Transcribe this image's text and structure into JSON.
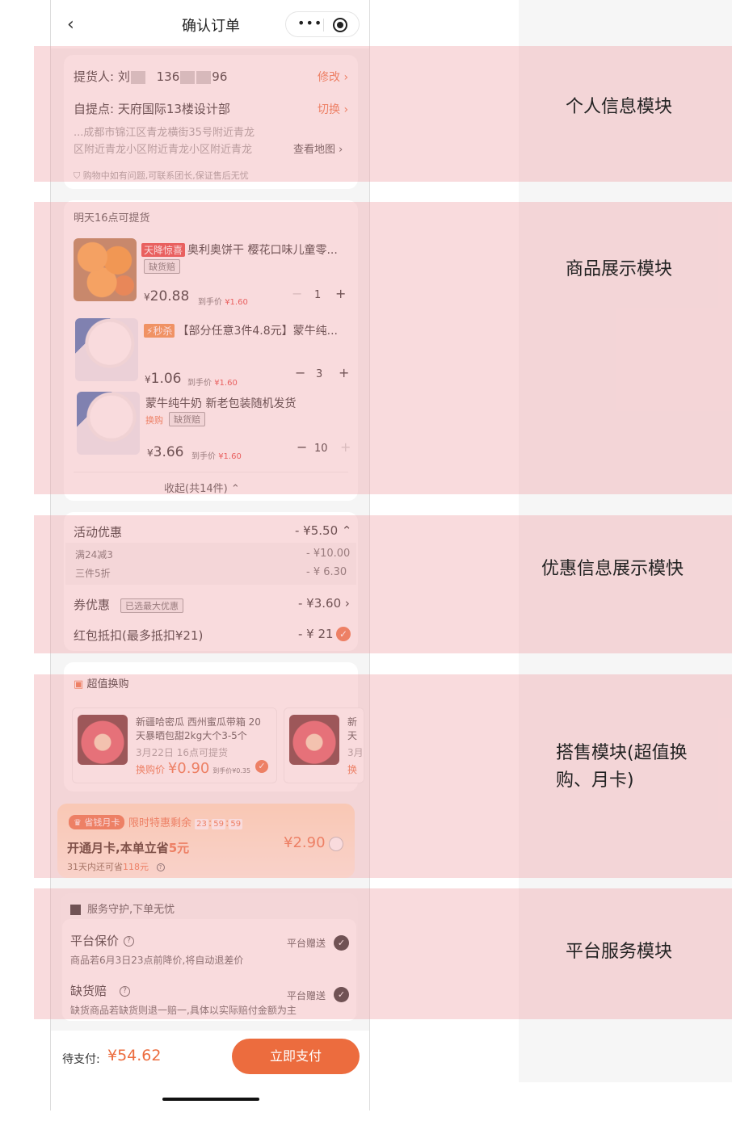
{
  "nav": {
    "back_icon": "‹",
    "title": "确认订单",
    "more_icon": "•••"
  },
  "person": {
    "picker_label": "提货人:",
    "picker_name": "刘",
    "phone_start": "136",
    "phone_end": "96",
    "edit": "修改",
    "pickup_label": "自提点:",
    "pickup_name": "天府国际13楼设计部",
    "switch": "切换",
    "addr1": "...成都市锦江区青龙横街35号附近青龙",
    "addr2": "区附近青龙小区附近青龙小区附近青龙",
    "view_map": "查看地图",
    "guarantee": "购物中如有问题,可联系团长,保证售后无忧"
  },
  "products": {
    "pickup_time": "明天16点可提货",
    "items": [
      {
        "tag": "天降惊喜",
        "name": "奥利奥饼干 樱花口味儿童零...",
        "badge": "缺货赔",
        "price": "20.88",
        "after_label": "到手价",
        "after_price": "¥1.60",
        "qty": "1"
      },
      {
        "tag": "秒杀",
        "name": "【部分任意3件4.8元】蒙牛纯...",
        "price": "1.06",
        "after_label": "到手价",
        "after_price": "¥1.60",
        "qty": "3"
      },
      {
        "name": "蒙牛纯牛奶 新老包装随机发货",
        "swap": "换购",
        "badge": "缺货赔",
        "price": "3.66",
        "after_label": "到手价",
        "after_price": "¥1.60",
        "qty": "10"
      }
    ],
    "collapse": "收起(共14件)",
    "currency": "¥"
  },
  "discount": {
    "activity_label": "活动优惠",
    "activity_amount": "- ¥5.50",
    "sub1_label": "满24减3",
    "sub1_amount": "- ¥10.00",
    "sub2_label": "三件5折",
    "sub2_amount": "- ¥ 6.30",
    "coupon_label": "券优惠",
    "coupon_badge": "已选最大优惠",
    "coupon_amount": "- ¥3.60",
    "redpack_label": "红包抵扣(最多抵扣¥21)",
    "redpack_amount": "- ¥ 21"
  },
  "swap": {
    "title": "超值换购",
    "item_title1": "新疆哈密瓜 西州蜜瓜带箱 20",
    "item_title2": "天暴晒包甜2kg大个3-5个",
    "item_time": "3月22日 16点可提货",
    "item_price_label": "换购价",
    "item_price": "¥0.90",
    "item_after": "到手价¥0.35",
    "peek_title1": "新",
    "peek_title2": "天",
    "peek_time": "3月",
    "peek_price": "换"
  },
  "month_card": {
    "badge": "省钱月卡",
    "promo": "限时特惠剩余",
    "t_h": "23",
    "t_m": "59",
    "t_s": "59",
    "headline_a": "开通月卡,本单立省",
    "headline_b": "5元",
    "sub_a": "31天内还可省",
    "sub_b": "118元",
    "price": "¥2.90"
  },
  "service": {
    "header": "服务守护,下单无忧",
    "s1_title": "平台保价",
    "s1_desc": "商品若6月3日23点前降价,将自动退差价",
    "s1_gift": "平台赠送",
    "s2_title": "缺货赔",
    "s2_desc": "缺货商品若缺货则退一赔一,具体以实际赔付金额为主",
    "s2_gift": "平台赠送"
  },
  "bottom": {
    "pay_label": "待支付:",
    "pay_amount": "¥54.62",
    "pay_button": "立即支付"
  },
  "annotations": {
    "a1": "个人信息模块",
    "a2": "商品展示模块",
    "a3": "优惠信息展示模快",
    "a4_line1": "搭售模块(超值换",
    "a4_line2": "购、月卡)",
    "a5": "平台服务模块"
  }
}
